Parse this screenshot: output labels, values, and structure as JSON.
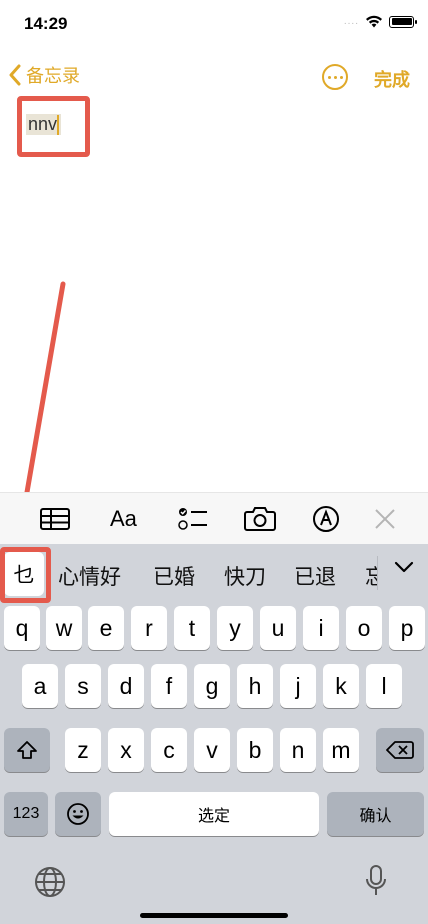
{
  "status_bar": {
    "time": "14:29",
    "signal": "...."
  },
  "nav": {
    "back_label": "备忘录",
    "done_label": "完成"
  },
  "note": {
    "text": "nnv"
  },
  "toolbar": {
    "format_label": "Aa"
  },
  "keyboard": {
    "candidates": [
      "乜",
      "心情好",
      "已婚",
      "快刀",
      "已退",
      "忘"
    ],
    "row1": [
      "q",
      "w",
      "e",
      "r",
      "t",
      "y",
      "u",
      "i",
      "o",
      "p"
    ],
    "row2": [
      "a",
      "s",
      "d",
      "f",
      "g",
      "h",
      "j",
      "k",
      "l"
    ],
    "row3": [
      "z",
      "x",
      "c",
      "v",
      "b",
      "n",
      "m"
    ],
    "numbers_key": "123",
    "space_key": "选定",
    "return_key": "确认"
  },
  "colors": {
    "accent": "#e0a928",
    "highlight": "#e45a4c",
    "keyboard_bg": "#d1d4da"
  }
}
